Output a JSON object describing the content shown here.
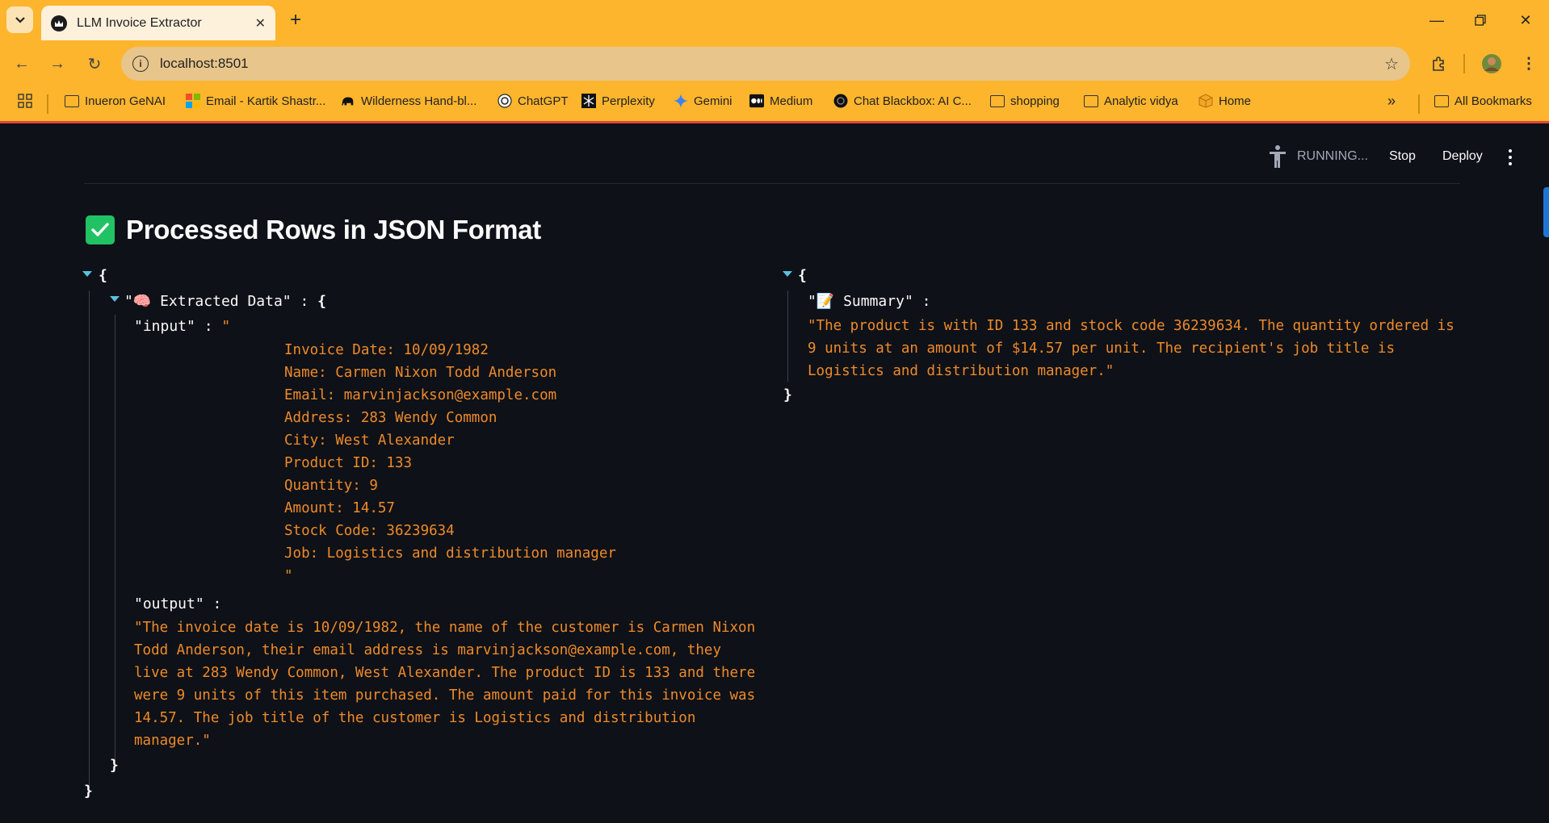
{
  "browser": {
    "tab_title": "LLM Invoice Extractor",
    "url": "localhost:8501",
    "bookmarks": [
      {
        "label": "Inueron GeNAI",
        "icon": "folder-icon"
      },
      {
        "label": "Email - Kartik Shastr...",
        "icon": "microsoft-icon"
      },
      {
        "label": "Wilderness Hand-bl...",
        "icon": "elephant-icon"
      },
      {
        "label": "ChatGPT",
        "icon": "chatgpt-icon"
      },
      {
        "label": "Perplexity",
        "icon": "perplexity-icon"
      },
      {
        "label": "Gemini",
        "icon": "gemini-icon"
      },
      {
        "label": "Medium",
        "icon": "medium-icon"
      },
      {
        "label": "Chat Blackbox: AI C...",
        "icon": "blackbox-icon"
      },
      {
        "label": "shopping",
        "icon": "folder-icon"
      },
      {
        "label": "Analytic vidya",
        "icon": "folder-icon"
      },
      {
        "label": "Home",
        "icon": "box-icon"
      }
    ],
    "all_bookmarks": "All Bookmarks",
    "accent": "#fdb52d"
  },
  "app_header": {
    "status": "RUNNING...",
    "stop": "Stop",
    "deploy": "Deploy"
  },
  "page": {
    "title": "Processed Rows in JSON Format",
    "left_json": {
      "open": "{",
      "close": "}",
      "extracted_key": "\"🧠 Extracted Data\"",
      "colon": ":",
      "inner_open": "{",
      "inner_close": "}",
      "input_key": "\"input\"",
      "input_quote_open": "\"",
      "input_lines": [
        "Invoice Date: 10/09/1982",
        "Name: Carmen Nixon Todd Anderson",
        "Email: marvinjackson@example.com",
        "Address: 283 Wendy Common",
        "City: West Alexander",
        "Product ID: 133",
        "Quantity: 9",
        "Amount: 14.57",
        "Stock Code: 36239634",
        "Job: Logistics and distribution manager",
        "\""
      ],
      "output_key": "\"output\"",
      "output_value": "\"The invoice date is 10/09/1982, the name of the customer is Carmen Nixon Todd Anderson, their email address is marvinjackson@example.com, they live at 283 Wendy Common, West Alexander. The product ID is 133 and there were 9 units of this item purchased. The amount paid for this invoice was 14.57. The job title of the customer is Logistics and distribution manager.\""
    },
    "right_json": {
      "open": "{",
      "close": "}",
      "summary_key": "\"📝 Summary\"",
      "colon": ":",
      "summary_value": "\"The product is with ID 133 and stock code 36239634. The quantity ordered is 9 units at an amount of $14.57 per unit. The recipient's job title is Logistics and distribution manager.\""
    },
    "colors": {
      "background": "#0e1117",
      "string": "#ee8a2a",
      "caret": "#5bc0de",
      "check": "#20c264"
    }
  }
}
